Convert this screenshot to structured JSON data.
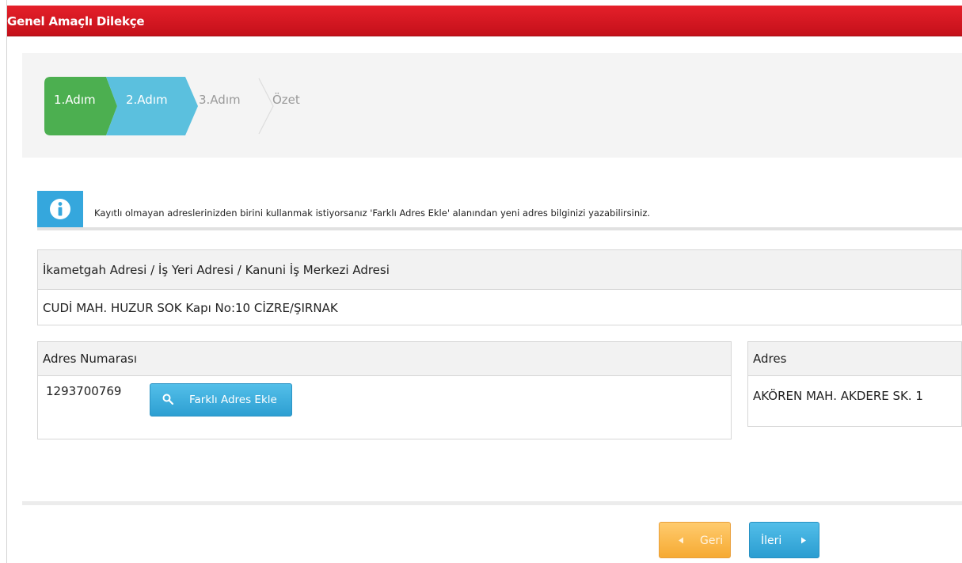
{
  "page": {
    "title": "Genel Amaçlı Dilekçe"
  },
  "wizard": {
    "steps": [
      {
        "label": "1.Adım",
        "state": "done",
        "color": "#4caf50"
      },
      {
        "label": "2.Adım",
        "state": "active",
        "color": "#5bc0de"
      },
      {
        "label": "3.Adım",
        "state": "pending"
      },
      {
        "label": "Özet",
        "state": "pending"
      }
    ]
  },
  "info": {
    "icon": "info-icon",
    "text": "Kayıtlı olmayan adreslerinizden birini kullanmak istiyorsanız  'Farklı Adres Ekle' alanından yeni adres bilginizi yazabilirsiniz."
  },
  "residence": {
    "header": "İkametgah Adresi / İş Yeri Adresi / Kanuni İş Merkezi Adresi",
    "value": "CUDİ MAH. HUZUR SOK Kapı No:10 CİZRE/ŞIRNAK"
  },
  "address_number": {
    "header": "Adres Numarası",
    "value": "1293700769",
    "button_label": "Farklı Adres Ekle",
    "button_icon": "search-icon"
  },
  "address": {
    "header": "Adres",
    "value": "AKÖREN MAH. AKDERE SK. 1"
  },
  "nav": {
    "back_label": "Geri",
    "next_label": "İleri"
  },
  "colors": {
    "title_bar": "#d0101b",
    "accent_blue": "#35a7dd",
    "step_done": "#4caf50",
    "step_active": "#5bc0de",
    "back_button": "#f6aa32"
  }
}
